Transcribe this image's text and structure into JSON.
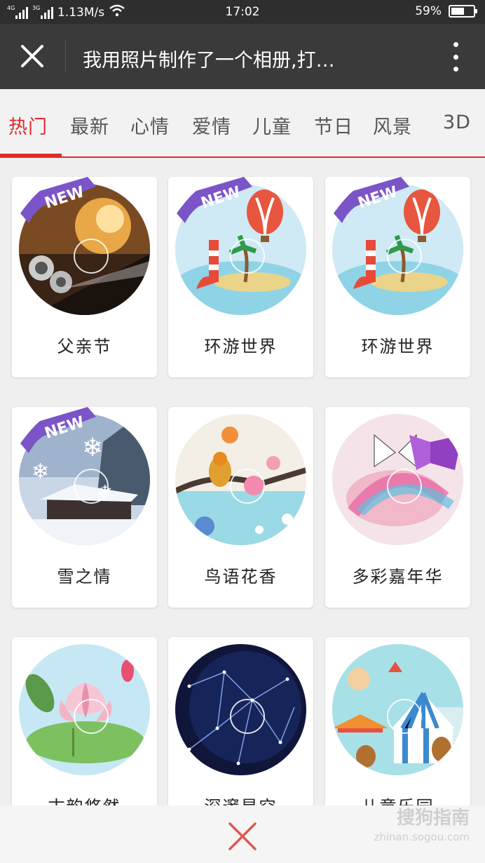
{
  "status": {
    "network_1": "4G",
    "network_2": "3G",
    "speed": "1.13M/s",
    "time": "17:02",
    "battery_text": "59%",
    "battery_level": 0.59
  },
  "header": {
    "title": "我用照片制作了一个相册,打…",
    "close_icon": "close-icon",
    "more_icon": "more-vertical-icon"
  },
  "tabs": [
    {
      "label": "热门",
      "active": true
    },
    {
      "label": "最新"
    },
    {
      "label": "心情"
    },
    {
      "label": "爱情"
    },
    {
      "label": "儿童"
    },
    {
      "label": "节日"
    },
    {
      "label": "风景"
    },
    {
      "label": "3D"
    }
  ],
  "albums": [
    {
      "label": "父亲节",
      "badge": "NEW"
    },
    {
      "label": "环游世界",
      "badge": "NEW"
    },
    {
      "label": "环游世界",
      "badge": "NEW"
    },
    {
      "label": "雪之情",
      "badge": "NEW"
    },
    {
      "label": "鸟语花香"
    },
    {
      "label": "多彩嘉年华"
    },
    {
      "label": "古韵悠然"
    },
    {
      "label": "深邃星空"
    },
    {
      "label": "儿童乐园"
    }
  ],
  "watermark": {
    "main": "搜狗指南",
    "sub": "zhinan.sogou.com"
  },
  "colors": {
    "accent": "#e02a2a",
    "badge": "#7b55c7",
    "header_bg": "#3a3a3a"
  }
}
